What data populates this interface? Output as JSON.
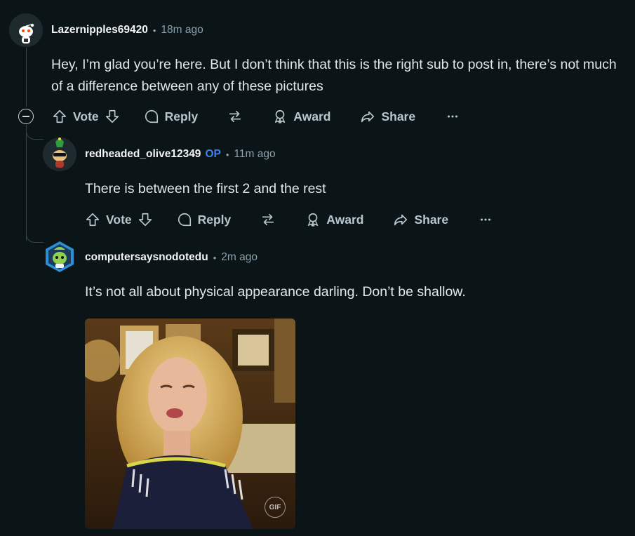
{
  "comments": [
    {
      "author": "Lazernipples69420",
      "time": "18m ago",
      "body": "Hey, I’m glad you’re here. But I don’t think that this is the right sub to post in, there’s not much of a difference between any of these pictures",
      "actions": {
        "vote": "Vote",
        "reply": "Reply",
        "award": "Award",
        "share": "Share"
      }
    },
    {
      "author": "redheaded_olive12349",
      "op_badge": "OP",
      "time": "11m ago",
      "body": "There is between the first 2 and the rest",
      "actions": {
        "vote": "Vote",
        "reply": "Reply",
        "award": "Award",
        "share": "Share"
      }
    },
    {
      "author": "computersaysnodotedu",
      "time": "2m ago",
      "body": "It’s not all about physical appearance darling. Don’t be shallow.",
      "gif_badge": "GIF"
    }
  ],
  "colors": {
    "background": "#0b1416",
    "op": "#3b82f6",
    "action_text": "#b7c7ce",
    "meta_text": "#8ba2ad"
  }
}
